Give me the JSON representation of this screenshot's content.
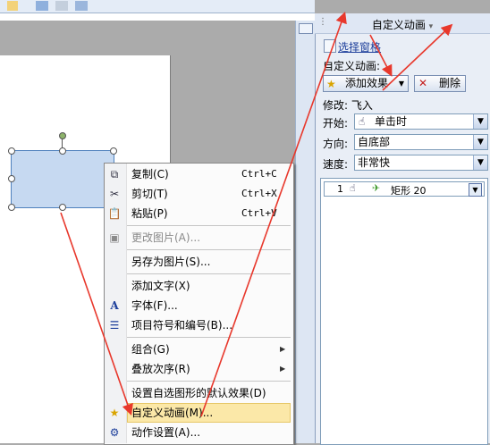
{
  "task_pane": {
    "title": "自定义动画",
    "title_caret": "▾",
    "select_pane_link": "选择窗格",
    "custom_anim_label": "自定义动画:",
    "add_effect_button": "添加效果",
    "remove_button": "删除",
    "modify_label": "修改: 飞入",
    "start_label": "开始:",
    "start_value": "单击时",
    "direction_label": "方向:",
    "direction_value": "自底部",
    "speed_label": "速度:",
    "speed_value": "非常快",
    "list_item": {
      "index": "1",
      "name": "矩形 20"
    }
  },
  "context_menu": {
    "items": [
      {
        "label": "复制(C)",
        "shortcut": "Ctrl+C",
        "icon": "copy-icon"
      },
      {
        "label": "剪切(T)",
        "shortcut": "Ctrl+X",
        "icon": "cut-icon"
      },
      {
        "label": "粘贴(P)",
        "shortcut": "Ctrl+V",
        "icon": "paste-icon"
      },
      {
        "label": "更改图片(A)...",
        "disabled": true,
        "icon": "change-picture-icon"
      },
      {
        "label": "另存为图片(S)..."
      },
      {
        "label": "添加文字(X)"
      },
      {
        "label": "字体(F)...",
        "icon": "font-icon"
      },
      {
        "label": "项目符号和编号(B)...",
        "icon": "bullets-icon"
      },
      {
        "label": "组合(G)",
        "submenu": true
      },
      {
        "label": "叠放次序(R)",
        "submenu": true
      },
      {
        "label": "设置自选图形的默认效果(D)"
      },
      {
        "label": "自定义动画(M)...",
        "highlighted": true,
        "icon": "custom-animation-icon"
      },
      {
        "label": "动作设置(A)...",
        "icon": "action-settings-icon"
      }
    ]
  },
  "colors": {
    "accent_arrow": "#e8382c",
    "highlight": "#fbe8a8",
    "shape_fill": "#c6d9f1"
  }
}
